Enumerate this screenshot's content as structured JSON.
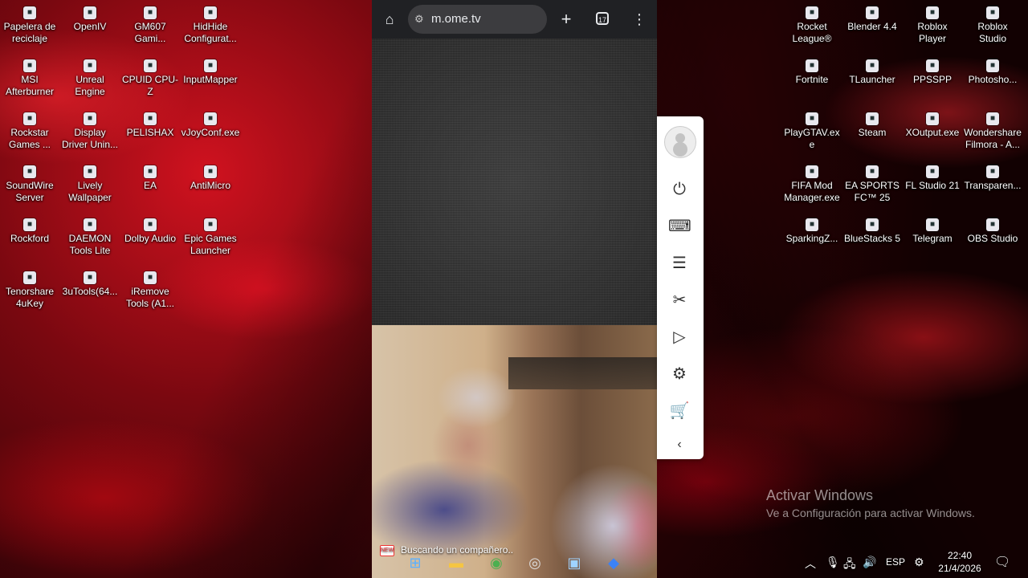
{
  "desktop_left": [
    {
      "label": "Papelera de reciclaje",
      "icon": "recycle-bin-icon"
    },
    {
      "label": "OpenIV",
      "icon": "openiv-icon"
    },
    {
      "label": "GM607 Gami...",
      "icon": "gm607-icon"
    },
    {
      "label": "HidHide Configurat...",
      "icon": "hidhide-icon"
    },
    {
      "label": "MSI Afterburner",
      "icon": "msi-afterburner-icon"
    },
    {
      "label": "Unreal Engine",
      "icon": "unreal-engine-icon"
    },
    {
      "label": "CPUID CPU-Z",
      "icon": "cpuz-icon"
    },
    {
      "label": "InputMapper",
      "icon": "inputmapper-icon"
    },
    {
      "label": "Rockstar Games ...",
      "icon": "rockstar-icon"
    },
    {
      "label": "Display Driver Unin...",
      "icon": "ddu-icon"
    },
    {
      "label": "PELISHAX",
      "icon": "pelishax-icon"
    },
    {
      "label": "vJoyConf.exe",
      "icon": "vjoy-icon"
    },
    {
      "label": "SoundWire Server",
      "icon": "soundwire-icon"
    },
    {
      "label": "Lively Wallpaper",
      "icon": "lively-icon"
    },
    {
      "label": "EA",
      "icon": "ea-icon"
    },
    {
      "label": "AntiMicro",
      "icon": "antimicro-icon"
    },
    {
      "label": "Rockford",
      "icon": "rockford-icon"
    },
    {
      "label": "DAEMON Tools Lite",
      "icon": "daemon-tools-icon"
    },
    {
      "label": "Dolby Audio",
      "icon": "dolby-icon"
    },
    {
      "label": "Epic Games Launcher",
      "icon": "epic-games-icon"
    },
    {
      "label": "Tenorshare 4uKey",
      "icon": "tenorshare-icon"
    },
    {
      "label": "3uTools(64...",
      "icon": "3utools-icon"
    },
    {
      "label": "iRemove Tools (A1...",
      "icon": "iremove-icon"
    }
  ],
  "desktop_right": [
    {
      "label": "Rocket League®",
      "icon": "rocket-league-icon"
    },
    {
      "label": "Blender 4.4",
      "icon": "blender-icon"
    },
    {
      "label": "Roblox Player",
      "icon": "roblox-player-icon"
    },
    {
      "label": "Roblox Studio",
      "icon": "roblox-studio-icon"
    },
    {
      "label": "Fortnite",
      "icon": "fortnite-icon"
    },
    {
      "label": "TLauncher",
      "icon": "tlauncher-icon"
    },
    {
      "label": "PPSSPP",
      "icon": "ppsspp-icon"
    },
    {
      "label": "Photosho...",
      "icon": "photoshop-icon"
    },
    {
      "label": "PlayGTAV.exe",
      "icon": "playgtav-icon"
    },
    {
      "label": "Steam",
      "icon": "steam-icon"
    },
    {
      "label": "XOutput.exe",
      "icon": "xoutput-icon"
    },
    {
      "label": "Wondershare Filmora - A...",
      "icon": "filmora-icon"
    },
    {
      "label": "FIFA Mod Manager.exe",
      "icon": "fifa-mod-icon"
    },
    {
      "label": "EA SPORTS FC™ 25",
      "icon": "easports-fc-icon"
    },
    {
      "label": "FL Studio 21",
      "icon": "fl-studio-icon"
    },
    {
      "label": "Transparen...",
      "icon": "transparent-icon"
    },
    {
      "label": "SparkingZ...",
      "icon": "sparkingz-icon"
    },
    {
      "label": "BlueStacks 5",
      "icon": "bluestacks-icon"
    },
    {
      "label": "Telegram",
      "icon": "telegram-icon"
    },
    {
      "label": "OBS Studio",
      "icon": "obs-icon"
    }
  ],
  "browser": {
    "url": "m.ome.tv",
    "tab_count": "17",
    "status": "Buscando un compañero..",
    "status_badge": "NEW"
  },
  "activation": {
    "title": "Activar Windows",
    "subtitle": "Ve a Configuración para activar Windows."
  },
  "tray": {
    "language": "ESP",
    "time": "22:40",
    "date": "21/4/2026"
  }
}
